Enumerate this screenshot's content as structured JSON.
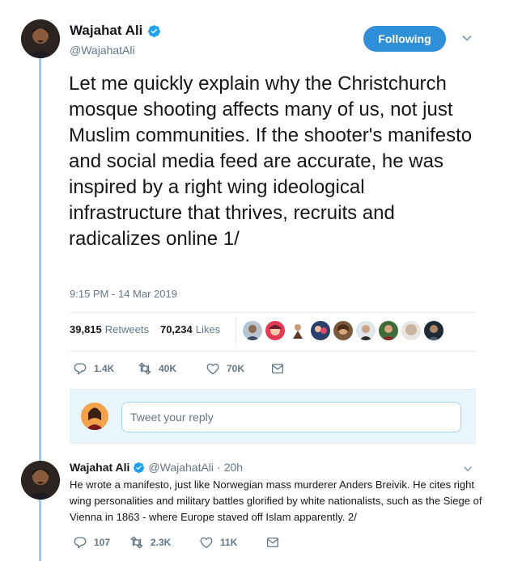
{
  "author": {
    "display_name": "Wajahat Ali",
    "handle": "@WajahatAli"
  },
  "follow_button": {
    "label": "Following"
  },
  "tweet": {
    "text": "Let me quickly explain why the Christchurch mosque shooting affects many of us, not just Muslim communities. If the shooter's manifesto and social media feed are accurate, he was inspired by a right wing ideological infrastructure that thrives, recruits and radicalizes online 1/",
    "timestamp": "9:15 PM - 14 Mar 2019",
    "retweets_count": "39,815",
    "retweets_label": "Retweets",
    "likes_count": "70,234",
    "likes_label": "Likes",
    "actions": {
      "replies": "1.4K",
      "retweets": "40K",
      "likes": "70K"
    }
  },
  "reply_box": {
    "placeholder": "Tweet your reply"
  },
  "reply_tweet": {
    "display_name": "Wajahat Ali",
    "handle": "@WajahatAli",
    "separator": "·",
    "time": "20h",
    "text": "He wrote a manifesto, just like Norwegian mass murderer Anders Breivik. He cites right wing personalities and military battles glorified by white nationalists, such as the Siege of Vienna in 1863 - where Europe staved off Islam apparently. 2/",
    "actions": {
      "replies": "107",
      "retweets": "2.3K",
      "likes": "11K"
    }
  },
  "colors": {
    "accent": "#1da1f2",
    "follow_button": "#2f8fd8",
    "thread_line": "#9ecbf2",
    "muted_text": "#657786",
    "reply_box_bg": "#e8f5fd"
  },
  "icons": [
    "verified-icon",
    "chevron-down-icon",
    "reply-icon",
    "retweet-icon",
    "like-icon",
    "direct-message-icon"
  ]
}
